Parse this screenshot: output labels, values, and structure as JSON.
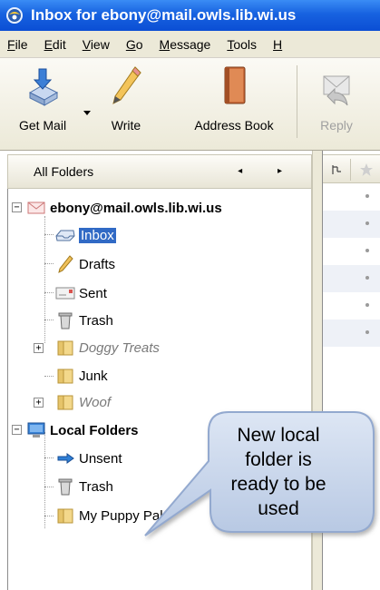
{
  "window": {
    "title": "Inbox for ebony@mail.owls.lib.wi.us"
  },
  "menu": [
    {
      "pre": "",
      "u": "F",
      "post": "ile"
    },
    {
      "pre": "",
      "u": "E",
      "post": "dit"
    },
    {
      "pre": "",
      "u": "V",
      "post": "iew"
    },
    {
      "pre": "",
      "u": "G",
      "post": "o"
    },
    {
      "pre": "",
      "u": "M",
      "post": "essage"
    },
    {
      "pre": "",
      "u": "T",
      "post": "ools"
    },
    {
      "pre": "",
      "u": "H",
      "post": ""
    }
  ],
  "toolbar": {
    "get_mail": "Get Mail",
    "write": "Write",
    "address_book": "Address Book",
    "reply": "Reply"
  },
  "folder_pane": {
    "header": "All Folders",
    "nav_arrows": "◂ ▸"
  },
  "accounts": [
    {
      "name": "ebony@mail.owls.lib.wi.us",
      "expander": "−",
      "folders": [
        "Inbox",
        "Drafts",
        "Sent",
        "Trash",
        "Doggy Treats",
        "Junk",
        "Woof"
      ]
    },
    {
      "name": "Local Folders",
      "expander": "−",
      "folders": [
        "Unsent",
        "Trash",
        "My Puppy Pals"
      ]
    }
  ],
  "subfolder_expander": "+",
  "callout": {
    "lines": [
      "New local",
      "folder is",
      "ready to be",
      "used"
    ],
    "fill": "#c5d3e9",
    "border": "#93a9cf"
  },
  "colors": {
    "titlebar": "#1762e0",
    "selection": "#316ac5"
  }
}
